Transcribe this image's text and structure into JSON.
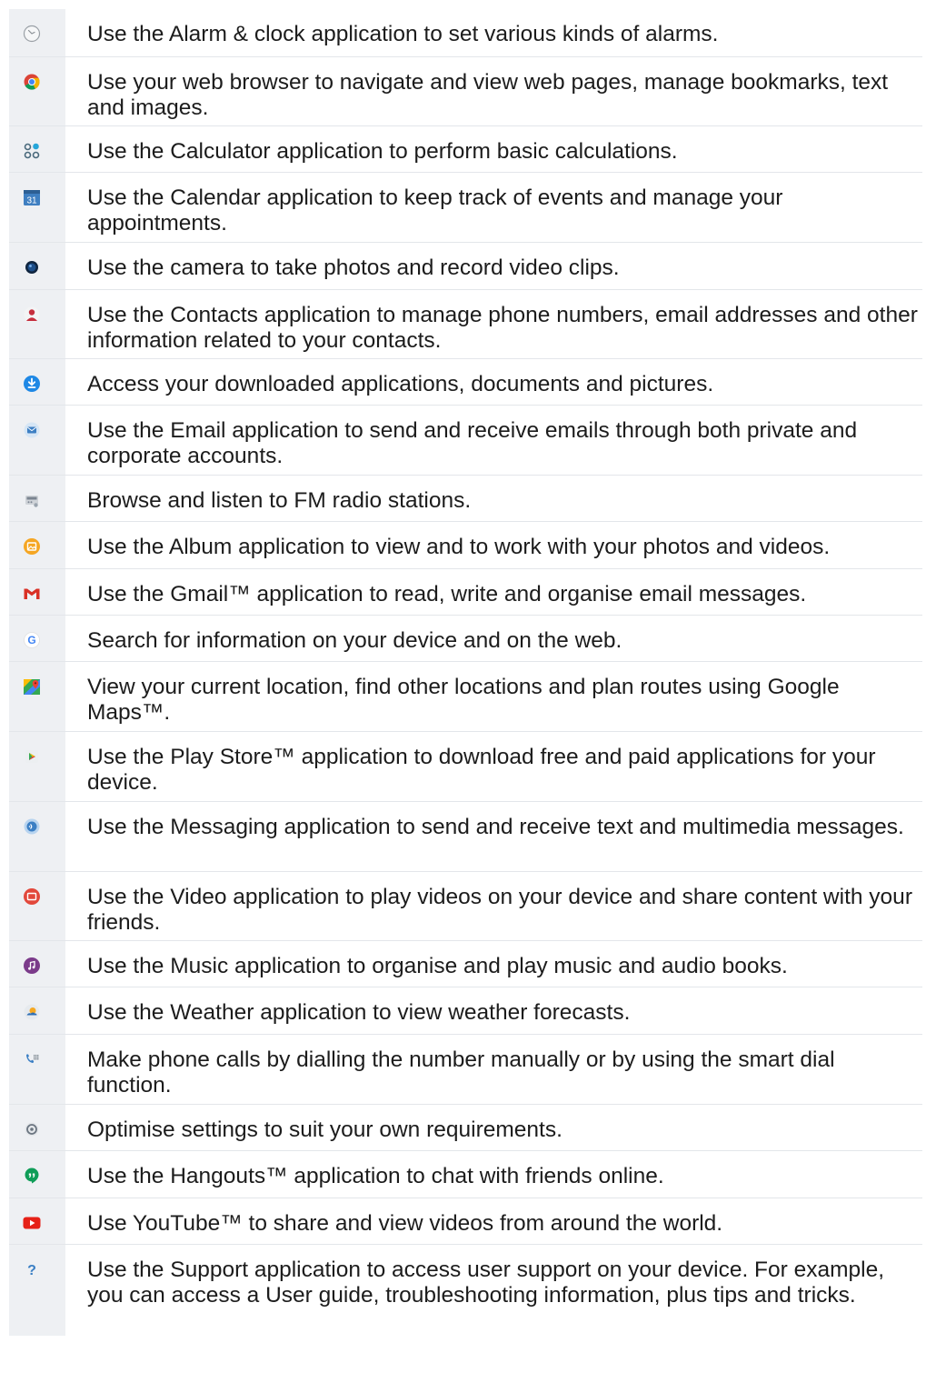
{
  "items": [
    {
      "icon": "alarm-clock-icon",
      "text": "Use the Alarm & clock application to set various kinds of alarms."
    },
    {
      "icon": "chrome-browser-icon",
      "text": "Use your web browser to navigate and view web pages, manage bookmarks, text and images."
    },
    {
      "icon": "calculator-icon",
      "text": "Use the Calculator application to perform basic calculations."
    },
    {
      "icon": "calendar-icon",
      "text": "Use the Calendar application to keep track of events and manage your appointments.",
      "icon_label": "31"
    },
    {
      "icon": "camera-icon",
      "text": "Use the camera to take photos and record video clips."
    },
    {
      "icon": "contacts-icon",
      "text": "Use the Contacts application to manage phone numbers, email addresses and other information related to your contacts."
    },
    {
      "icon": "download-icon",
      "text": "Access your downloaded applications, documents and pictures."
    },
    {
      "icon": "email-icon",
      "text": "Use the Email application to send and receive emails through both private and corporate accounts."
    },
    {
      "icon": "fm-radio-icon",
      "text": "Browse and listen to FM radio stations."
    },
    {
      "icon": "album-icon",
      "text": "Use the Album application to view and to work with your photos and videos."
    },
    {
      "icon": "gmail-icon",
      "text": "Use the Gmail™ application to read, write and organise email messages."
    },
    {
      "icon": "google-search-icon",
      "text": "Search for information on your device and on the web.",
      "icon_label": "G"
    },
    {
      "icon": "google-maps-icon",
      "text": "View your current location, find other locations and plan routes using Google Maps™."
    },
    {
      "icon": "play-store-icon",
      "text": "Use the Play Store™ application to download free and paid applications for your device."
    },
    {
      "icon": "messaging-icon",
      "text": "Use the Messaging application to send and receive text and multimedia messages."
    },
    {
      "icon": "video-icon",
      "text": "Use the Video application to play videos on your device and share content with your friends."
    },
    {
      "icon": "music-icon",
      "text": "Use the Music application to organise and play music and audio books."
    },
    {
      "icon": "weather-icon",
      "text": "Use the Weather application to view weather forecasts."
    },
    {
      "icon": "phone-icon",
      "text": "Make phone calls by dialling the number manually or by using the smart dial function."
    },
    {
      "icon": "settings-icon",
      "text": "Optimise settings to suit your own requirements."
    },
    {
      "icon": "hangouts-icon",
      "text": "Use the Hangouts™ application to chat with friends online."
    },
    {
      "icon": "youtube-icon",
      "text": "Use YouTube™ to share and view videos from around the world."
    },
    {
      "icon": "support-icon",
      "text": "Use the Support application to access user support on your device. For example, you can access a User guide, troubleshooting information, plus tips and tricks.",
      "icon_label": "?"
    }
  ]
}
